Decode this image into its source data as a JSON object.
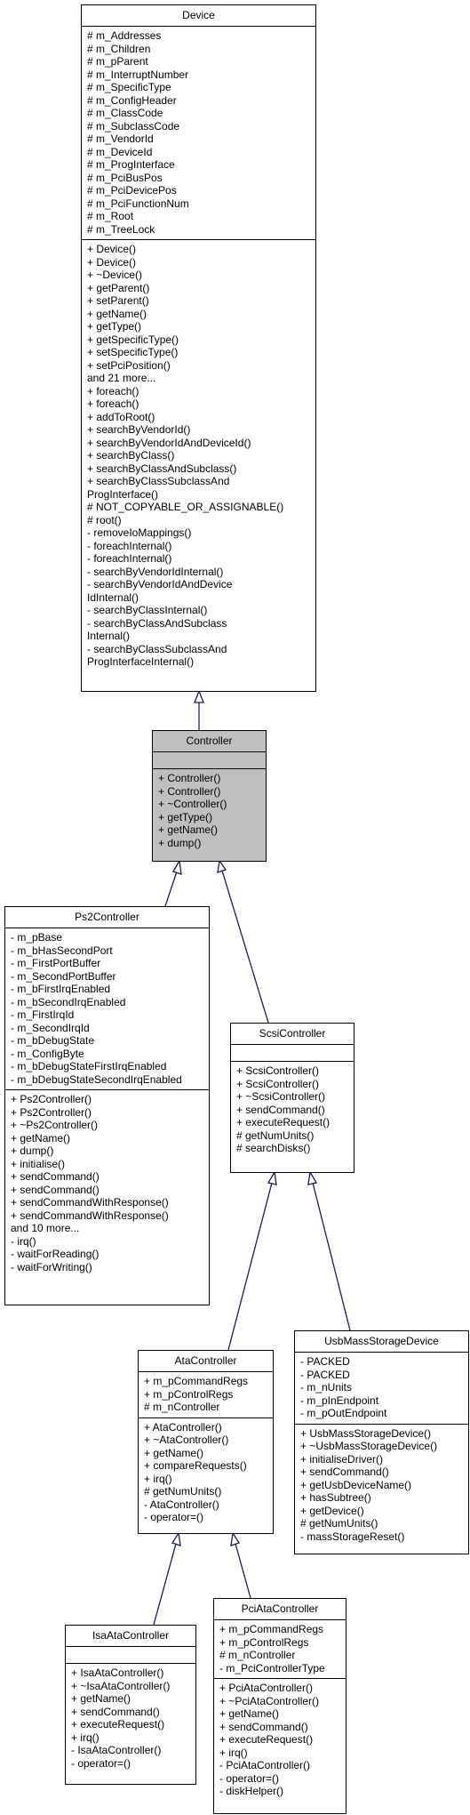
{
  "diagram": {
    "type": "class-inheritance",
    "edge_color": "#191970",
    "highlight_fill": "#bfbfbf",
    "classes": {
      "device": {
        "name": "Device",
        "attributes": [
          "# m_Addresses",
          "# m_Children",
          "# m_pParent",
          "# m_InterruptNumber",
          "# m_SpecificType",
          "# m_ConfigHeader",
          "# m_ClassCode",
          "# m_SubclassCode",
          "# m_VendorId",
          "# m_DeviceId",
          "# m_ProgInterface",
          "# m_PciBusPos",
          "# m_PciDevicePos",
          "# m_PciFunctionNum",
          "# m_Root",
          "# m_TreeLock"
        ],
        "methods": [
          "+ Device()",
          "+ Device()",
          "+ ~Device()",
          "+ getParent()",
          "+ setParent()",
          "+ getName()",
          "+ getType()",
          "+ getSpecificType()",
          "+ setSpecificType()",
          "+ setPciPosition()",
          "and 21 more...",
          "+ foreach()",
          "+ foreach()",
          "+ addToRoot()",
          "+ searchByVendorId()",
          "+ searchByVendorIdAndDeviceId()",
          "+ searchByClass()",
          "+ searchByClassAndSubclass()",
          "+ searchByClassSubclassAnd",
          "ProgInterface()",
          "# NOT_COPYABLE_OR_ASSIGNABLE()",
          "# root()",
          "- removeIoMappings()",
          "- foreachInternal()",
          "- foreachInternal()",
          "- searchByVendorIdInternal()",
          "- searchByVendorIdAndDevice",
          "IdInternal()",
          "- searchByClassInternal()",
          "- searchByClassAndSubclass",
          "Internal()",
          "- searchByClassSubclassAnd",
          "ProgInterfaceInternal()"
        ]
      },
      "controller": {
        "name": "Controller",
        "highlighted": true,
        "attributes": [],
        "methods": [
          "+ Controller()",
          "+ Controller()",
          "+ ~Controller()",
          "+ getType()",
          "+ getName()",
          "+ dump()"
        ]
      },
      "ps2controller": {
        "name": "Ps2Controller",
        "attributes": [
          "- m_pBase",
          "- m_bHasSecondPort",
          "- m_FirstPortBuffer",
          "- m_SecondPortBuffer",
          "- m_bFirstIrqEnabled",
          "- m_bSecondIrqEnabled",
          "- m_FirstIrqId",
          "- m_SecondIrqId",
          "- m_bDebugState",
          "- m_ConfigByte",
          "- m_bDebugStateFirstIrqEnabled",
          "- m_bDebugStateSecondIrqEnabled"
        ],
        "methods": [
          "+ Ps2Controller()",
          "+ Ps2Controller()",
          "+ ~Ps2Controller()",
          "+ getName()",
          "+ dump()",
          "+ initialise()",
          "+ sendCommand()",
          "+ sendCommand()",
          "+ sendCommandWithResponse()",
          "+ sendCommandWithResponse()",
          "and 10 more...",
          "- irq()",
          "- waitForReading()",
          "- waitForWriting()"
        ]
      },
      "scsicontroller": {
        "name": "ScsiController",
        "attributes": [],
        "methods": [
          "+ ScsiController()",
          "+ ScsiController()",
          "+ ~ScsiController()",
          "+ sendCommand()",
          "+ executeRequest()",
          "# getNumUnits()",
          "# searchDisks()"
        ]
      },
      "atacontroller": {
        "name": "AtaController",
        "attributes": [
          "+ m_pCommandRegs",
          "+ m_pControlRegs",
          "# m_nController"
        ],
        "methods": [
          "+ AtaController()",
          "+ ~AtaController()",
          "+ getName()",
          "+ compareRequests()",
          "+ irq()",
          "# getNumUnits()",
          "- AtaController()",
          "- operator=()"
        ]
      },
      "usbmassstoragedevice": {
        "name": "UsbMassStorageDevice",
        "attributes": [
          "- PACKED",
          "- PACKED",
          "- m_nUnits",
          "- m_pInEndpoint",
          "- m_pOutEndpoint"
        ],
        "methods": [
          "+ UsbMassStorageDevice()",
          "+ ~UsbMassStorageDevice()",
          "+ initialiseDriver()",
          "+ sendCommand()",
          "+ getUsbDeviceName()",
          "+ hasSubtree()",
          "+ getDevice()",
          "# getNumUnits()",
          "- massStorageReset()"
        ]
      },
      "isaatacontroller": {
        "name": "IsaAtaController",
        "attributes": [],
        "methods": [
          "+ IsaAtaController()",
          "+ ~IsaAtaController()",
          "+ getName()",
          "+ sendCommand()",
          "+ executeRequest()",
          "+ irq()",
          "- IsaAtaController()",
          "- operator=()"
        ]
      },
      "pciatacontroller": {
        "name": "PciAtaController",
        "attributes": [
          "+ m_pCommandRegs",
          "+ m_pControlRegs",
          "# m_nController",
          "- m_PciControllerType"
        ],
        "methods": [
          "+ PciAtaController()",
          "+ ~PciAtaController()",
          "+ getName()",
          "+ sendCommand()",
          "+ executeRequest()",
          "+ irq()",
          "- PciAtaController()",
          "- operator=()",
          "- diskHelper()"
        ]
      }
    },
    "inheritance": [
      {
        "child": "Controller",
        "parent": "Device"
      },
      {
        "child": "Ps2Controller",
        "parent": "Controller"
      },
      {
        "child": "ScsiController",
        "parent": "Controller"
      },
      {
        "child": "AtaController",
        "parent": "ScsiController"
      },
      {
        "child": "UsbMassStorageDevice",
        "parent": "ScsiController"
      },
      {
        "child": "IsaAtaController",
        "parent": "AtaController"
      },
      {
        "child": "PciAtaController",
        "parent": "AtaController"
      }
    ]
  }
}
